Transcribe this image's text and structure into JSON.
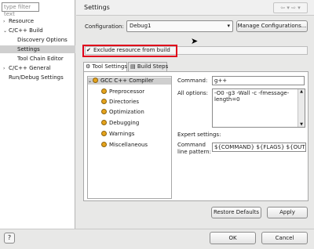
{
  "left": {
    "filter_placeholder": "type filter text",
    "items": [
      {
        "label": "Resource"
      },
      {
        "label": "C/C++ Build"
      },
      {
        "label": "Discovery Options"
      },
      {
        "label": "Settings"
      },
      {
        "label": "Tool Chain Editor"
      },
      {
        "label": "C/C++ General"
      },
      {
        "label": "Run/Debug Settings"
      }
    ]
  },
  "header": {
    "title": "Settings"
  },
  "config": {
    "label": "Configuration:",
    "value": "Debug1",
    "manage_button": "Manage Configurations..."
  },
  "exclude": {
    "label": "Exclude resource from build",
    "checked": true,
    "highlight_color": "#e0001b"
  },
  "tabs": [
    {
      "label": "Tool Settings"
    },
    {
      "label": "Build Steps"
    }
  ],
  "tools": {
    "root": "GCC C++ Compiler",
    "children": [
      "Preprocessor",
      "Directories",
      "Optimization",
      "Debugging",
      "Warnings",
      "Miscellaneous"
    ]
  },
  "command": {
    "label": "Command:",
    "value": "g++"
  },
  "all_options": {
    "label": "All options:",
    "line1": "-O0 -g3 -Wall -c -fmessage-",
    "line2": "length=0"
  },
  "expert": {
    "label": "Expert settings:",
    "pattern_label_1": "Command",
    "pattern_label_2": "line pattern:",
    "pattern_value": "${COMMAND} ${FLAGS} ${OUTI"
  },
  "buttons": {
    "restore": "Restore Defaults",
    "apply": "Apply",
    "ok": "OK",
    "cancel": "Cancel",
    "help": "?"
  }
}
